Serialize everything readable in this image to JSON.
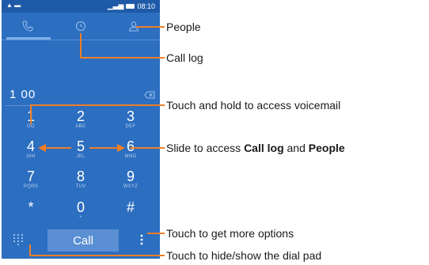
{
  "status_bar": {
    "icons_left": [
      "warning-icon",
      "message-icon"
    ],
    "time": "08:10"
  },
  "tabs": [
    {
      "icon": "phone-icon",
      "active": true
    },
    {
      "icon": "clock-icon",
      "active": false
    },
    {
      "icon": "person-icon",
      "active": false
    }
  ],
  "dialed_number": "1 00",
  "keypad": [
    {
      "digit": "1",
      "letters": "OO"
    },
    {
      "digit": "2",
      "letters": "ABC"
    },
    {
      "digit": "3",
      "letters": "DEF"
    },
    {
      "digit": "4",
      "letters": "GHI"
    },
    {
      "digit": "5",
      "letters": "JKL"
    },
    {
      "digit": "6",
      "letters": "MNO"
    },
    {
      "digit": "7",
      "letters": "PQRS"
    },
    {
      "digit": "8",
      "letters": "TUV"
    },
    {
      "digit": "9",
      "letters": "WXYZ"
    },
    {
      "digit": "*",
      "letters": ""
    },
    {
      "digit": "0",
      "letters": "+"
    },
    {
      "digit": "#",
      "letters": ""
    }
  ],
  "call_label": "Call",
  "annotations": {
    "people": "People",
    "call_log": "Call log",
    "voicemail": "Touch and hold to access voicemail",
    "slide_prefix": "Slide to access",
    "slide_call_log": "Call log",
    "slide_and": "and",
    "slide_people": "People",
    "more_options": "Touch to get more options",
    "dial_pad": "Touch to hide/show the dial pad"
  },
  "colors": {
    "screen_bg": "#2c6ec0",
    "accent": "#7fb0ea",
    "callout_line": "#f07e26"
  }
}
